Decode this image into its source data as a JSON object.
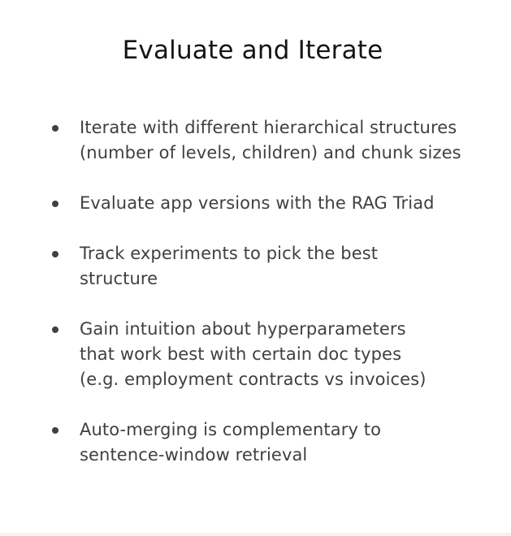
{
  "slide": {
    "title": "Evaluate and Iterate",
    "bullets": [
      {
        "line1": "Iterate with different hierarchical structures",
        "line2": "(number of levels, children) and chunk sizes",
        "line3": ""
      },
      {
        "line1": "Evaluate app versions with the RAG Triad",
        "line2": "",
        "line3": ""
      },
      {
        "line1": "Track experiments to pick the best",
        "line2": "structure",
        "line3": ""
      },
      {
        "line1": "Gain intuition about hyperparameters",
        "line2": "that work best with certain doc types",
        "line3": "(e.g. employment contracts vs invoices)"
      },
      {
        "line1": "Auto-merging is complementary to",
        "line2": "sentence-window retrieval",
        "line3": ""
      }
    ]
  }
}
